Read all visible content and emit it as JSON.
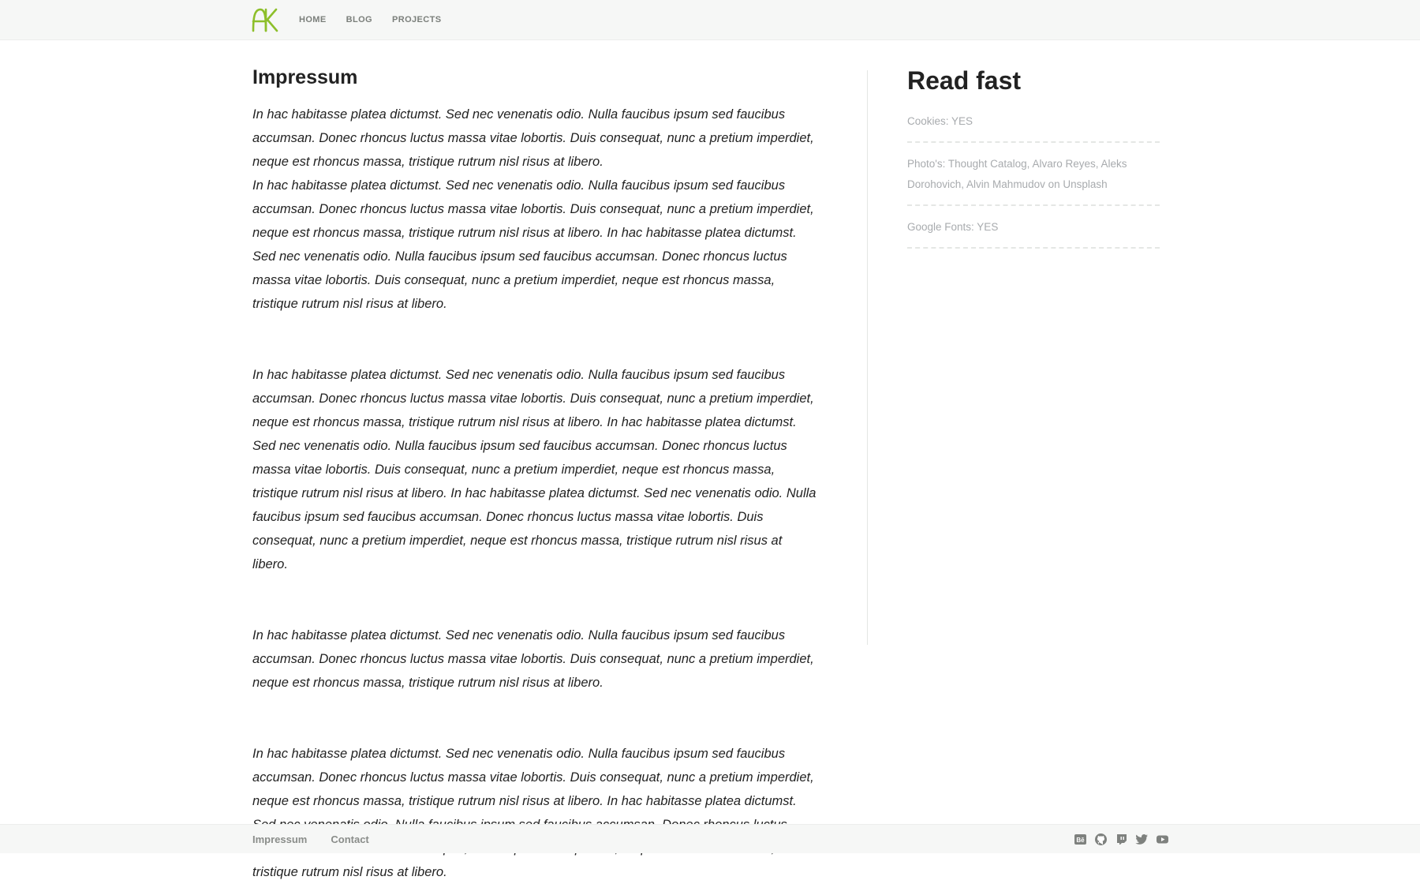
{
  "nav": {
    "logo_text": "AK",
    "items": [
      {
        "label": "HOME"
      },
      {
        "label": "BLOG"
      },
      {
        "label": "PROJECTS"
      }
    ]
  },
  "main": {
    "title": "Impressum",
    "paragraphs": [
      "In hac habitasse platea dictumst. Sed nec venenatis odio. Nulla faucibus ipsum sed faucibus accumsan. Donec rhoncus luctus massa vitae lobortis. Duis consequat, nunc a pretium imperdiet, neque est rhoncus massa, tristique rutrum nisl risus at libero.",
      "In hac habitasse platea dictumst. Sed nec venenatis odio. Nulla faucibus ipsum sed faucibus accumsan. Donec rhoncus luctus massa vitae lobortis. Duis consequat, nunc a pretium imperdiet, neque est rhoncus massa, tristique rutrum nisl risus at libero. In hac habitasse platea dictumst. Sed nec venenatis odio. Nulla faucibus ipsum sed faucibus accumsan. Donec rhoncus luctus massa vitae lobortis. Duis consequat, nunc a pretium imperdiet, neque est rhoncus massa, tristique rutrum nisl risus at libero.",
      "In hac habitasse platea dictumst. Sed nec venenatis odio. Nulla faucibus ipsum sed faucibus accumsan. Donec rhoncus luctus massa vitae lobortis. Duis consequat, nunc a pretium imperdiet, neque est rhoncus massa, tristique rutrum nisl risus at libero. In hac habitasse platea dictumst. Sed nec venenatis odio. Nulla faucibus ipsum sed faucibus accumsan. Donec rhoncus luctus massa vitae lobortis. Duis consequat, nunc a pretium imperdiet, neque est rhoncus massa, tristique rutrum nisl risus at libero. In hac habitasse platea dictumst. Sed nec venenatis odio. Nulla faucibus ipsum sed faucibus accumsan. Donec rhoncus luctus massa vitae lobortis. Duis consequat, nunc a pretium imperdiet, neque est rhoncus massa, tristique rutrum nisl risus at libero.",
      "In hac habitasse platea dictumst. Sed nec venenatis odio. Nulla faucibus ipsum sed faucibus accumsan. Donec rhoncus luctus massa vitae lobortis. Duis consequat, nunc a pretium imperdiet, neque est rhoncus massa, tristique rutrum nisl risus at libero.",
      "In hac habitasse platea dictumst. Sed nec venenatis odio. Nulla faucibus ipsum sed faucibus accumsan. Donec rhoncus luctus massa vitae lobortis. Duis consequat, nunc a pretium imperdiet, neque est rhoncus massa, tristique rutrum nisl risus at libero. In hac habitasse platea dictumst. Sed nec venenatis odio. Nulla faucibus ipsum sed faucibus accumsan. Donec rhoncus luctus massa vitae lobortis. Duis consequat, nunc a pretium imperdiet, neque est rhoncus massa, tristique rutrum nisl risus at libero."
    ]
  },
  "sidebar": {
    "title": "Read fast",
    "items": [
      {
        "text": "Cookies: YES"
      },
      {
        "text": "Photo's: Thought Catalog, Alvaro Reyes, Aleks Dorohovich, Alvin Mahmudov on Unsplash"
      },
      {
        "text": "Google Fonts: YES"
      }
    ]
  },
  "footer": {
    "links": [
      {
        "label": "Impressum"
      },
      {
        "label": "Contact"
      }
    ],
    "social_icons": [
      "behance-icon",
      "github-icon",
      "twitch-icon",
      "twitter-icon",
      "youtube-icon"
    ]
  },
  "colors": {
    "accent": "#8dbf2a",
    "topbar_bg": "#f6f7f6",
    "nav_text": "#7b7f7b",
    "body_text": "#222222",
    "sidebar_text": "#a8abae",
    "icon": "#7e817e"
  }
}
